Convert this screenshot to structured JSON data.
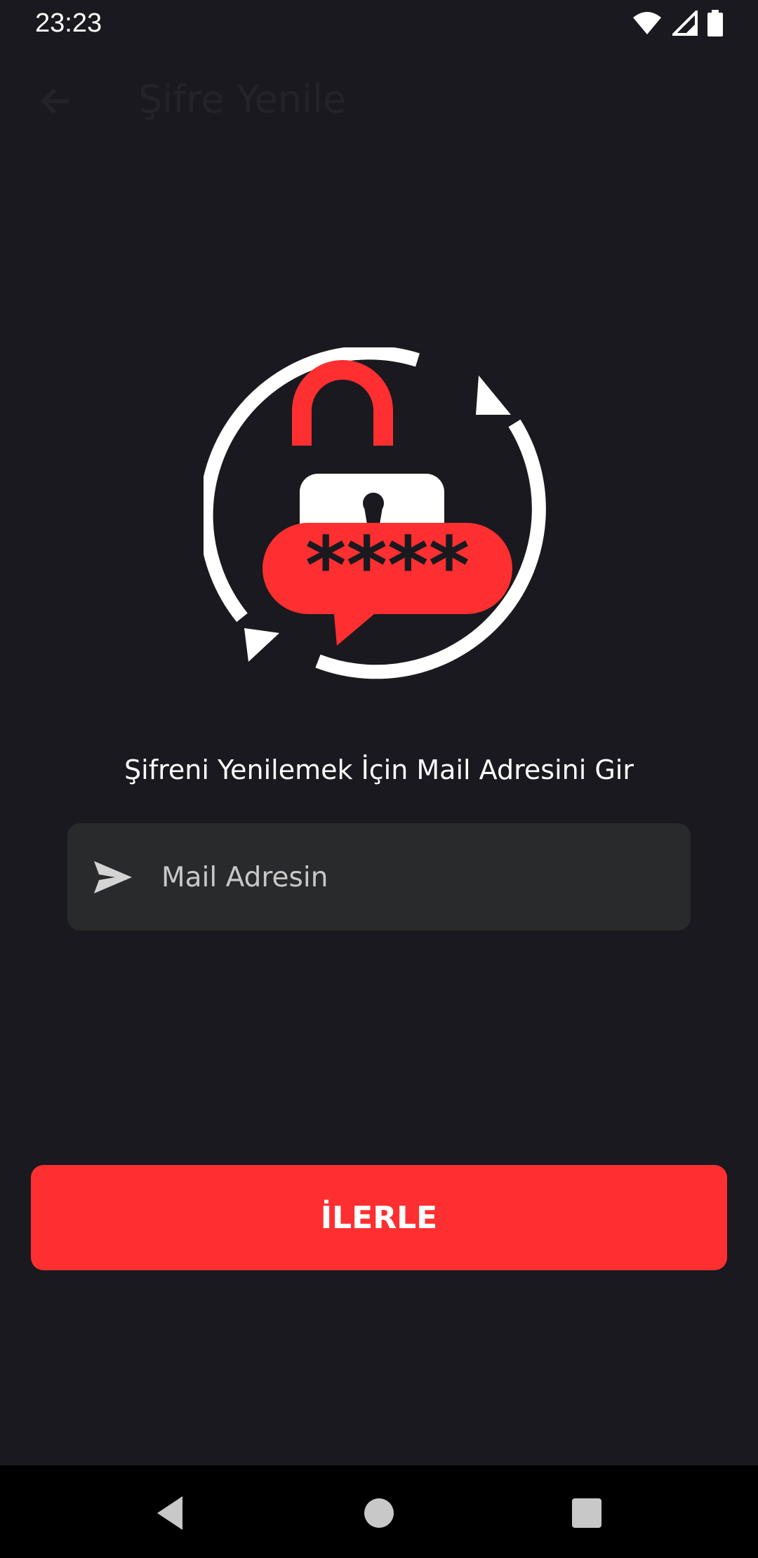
{
  "status_bar": {
    "time": "23:23"
  },
  "app_bar": {
    "title": "Şifre Yenile"
  },
  "content": {
    "prompt": "Şifreni Yenilemek İçin Mail Adresini Gir",
    "email_placeholder": "Mail Adresin",
    "email_value": "",
    "next_label": "İLERLE",
    "hero_asterisks": "****"
  },
  "colors": {
    "background": "#1a191f",
    "accent": "#fe2f30",
    "input_bg": "#292a2c",
    "nav_bg": "#000000"
  },
  "icons": [
    "wifi-icon",
    "signal-icon",
    "battery-icon",
    "back-arrow-icon",
    "lock-refresh-illustration",
    "send-icon",
    "nav-back-icon",
    "nav-home-icon",
    "nav-recents-icon"
  ]
}
